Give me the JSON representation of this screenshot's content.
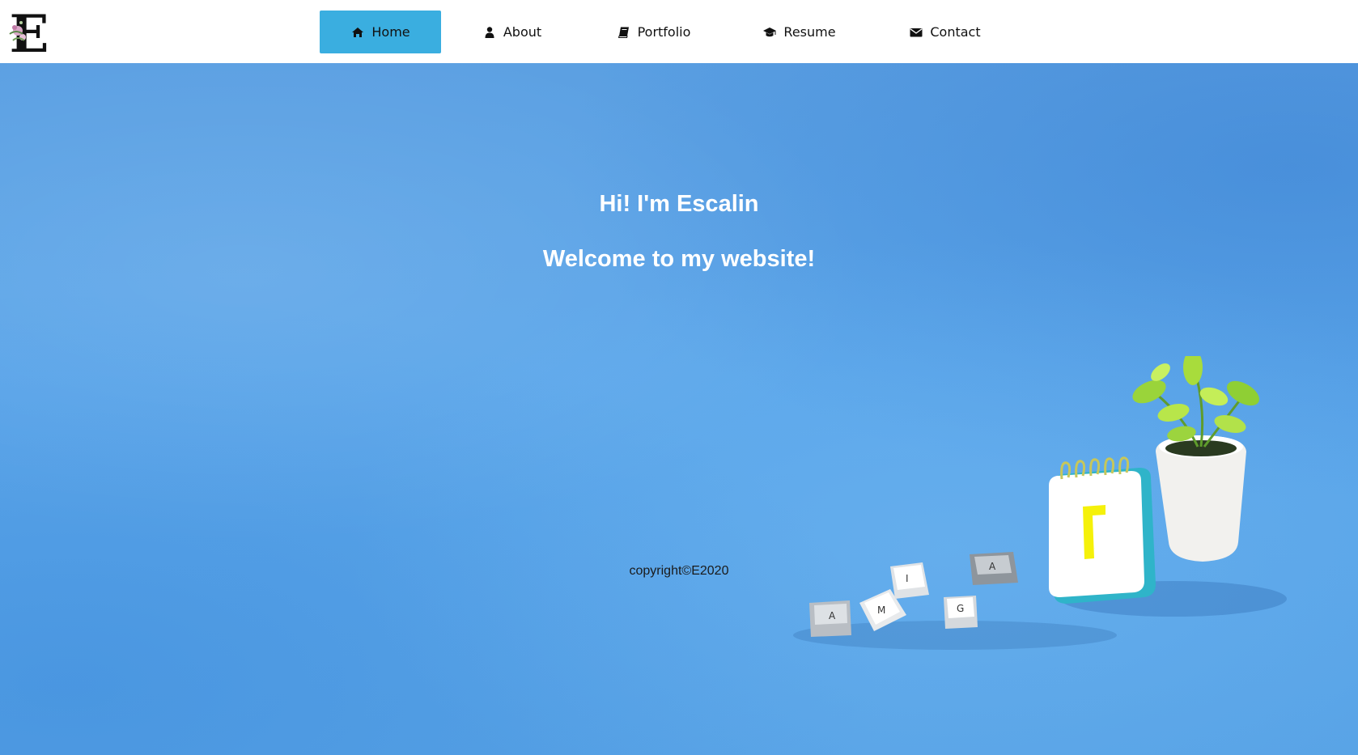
{
  "logo": {
    "letter": "E",
    "icon": "logo-letter-e-floral"
  },
  "nav": {
    "items": [
      {
        "label": "Home",
        "icon": "home-icon",
        "active": true
      },
      {
        "label": "About",
        "icon": "user-icon",
        "active": false
      },
      {
        "label": "Portfolio",
        "icon": "book-icon",
        "active": false
      },
      {
        "label": "Resume",
        "icon": "graduation-cap-icon",
        "active": false
      },
      {
        "label": "Contact",
        "icon": "envelope-icon",
        "active": false
      }
    ]
  },
  "hero": {
    "title": "Hi! I'm Escalin",
    "subtitle": "Welcome to my website!",
    "copyright": "copyright©E2020"
  },
  "decor": {
    "keycaps": [
      "A",
      "M",
      "I",
      "G",
      "A"
    ],
    "notepad_letter": "Γ"
  },
  "colors": {
    "nav_background": "#ffffff",
    "active_nav": "#3aaee0",
    "hero_background": "#5aa3e6",
    "hero_text": "#ffffff",
    "footer_text": "#1a1a1a"
  }
}
